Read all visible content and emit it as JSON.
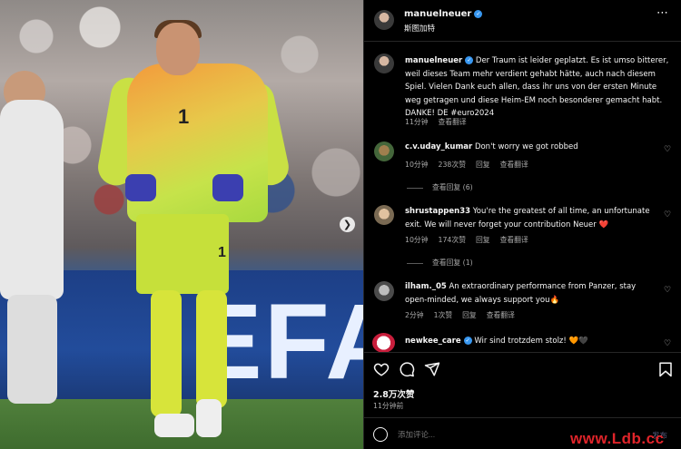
{
  "post": {
    "username": "manuelneuer",
    "subtitle": "斯图加特",
    "caption": "Der Traum ist leider geplatzt. Es ist umso bitterer, weil dieses Team mehr verdient gehabt hätte, auch nach diesem Spiel. Vielen Dank euch allen, dass ihr uns von der ersten Minute weg getragen und diese Heim-EM noch besonderer gemacht habt. DANKE! ",
    "caption_tail": "DE #euro2024",
    "caption_time": "11分钟",
    "caption_translate": "查看翻译",
    "likes": "2.8万次赞",
    "time": "11分钟前"
  },
  "photo": {
    "board_text": "EFA",
    "shirt_number": "1",
    "shorts_number": "1"
  },
  "comments": [
    {
      "username": "c.v.uday_kumar",
      "text": "Don't worry we got robbed",
      "time": "10分钟",
      "likes": "238次赞",
      "reply": "回复",
      "translate": "查看翻译",
      "replies": "查看回复 (6)"
    },
    {
      "username": "shrustappen33",
      "text": "You're the greatest of all time, an unfortunate exit. We will never forget your contribution Neuer ❤️",
      "time": "10分钟",
      "likes": "174次赞",
      "reply": "回复",
      "translate": "查看翻译",
      "replies": "查看回复 (1)"
    },
    {
      "username": "ilham._05",
      "text": "An extraordinary performance from Panzer, stay open-minded, we always support you🔥",
      "time": "2分钟",
      "likes": "1次赞",
      "reply": "回复",
      "translate": "查看翻译"
    },
    {
      "username": "newkee_care",
      "text": "Wir sind trotzdem stolz! 🧡🖤"
    }
  ],
  "composer": {
    "placeholder": "添加评论...",
    "publish": "发布"
  },
  "watermark": "www.Ldb.cc",
  "icons": {
    "more": "more-icon",
    "like": "heart-icon",
    "comment": "comment-icon",
    "share": "share-icon",
    "save": "bookmark-icon",
    "emoji": "emoji-icon",
    "next": "chevron-right-icon"
  }
}
